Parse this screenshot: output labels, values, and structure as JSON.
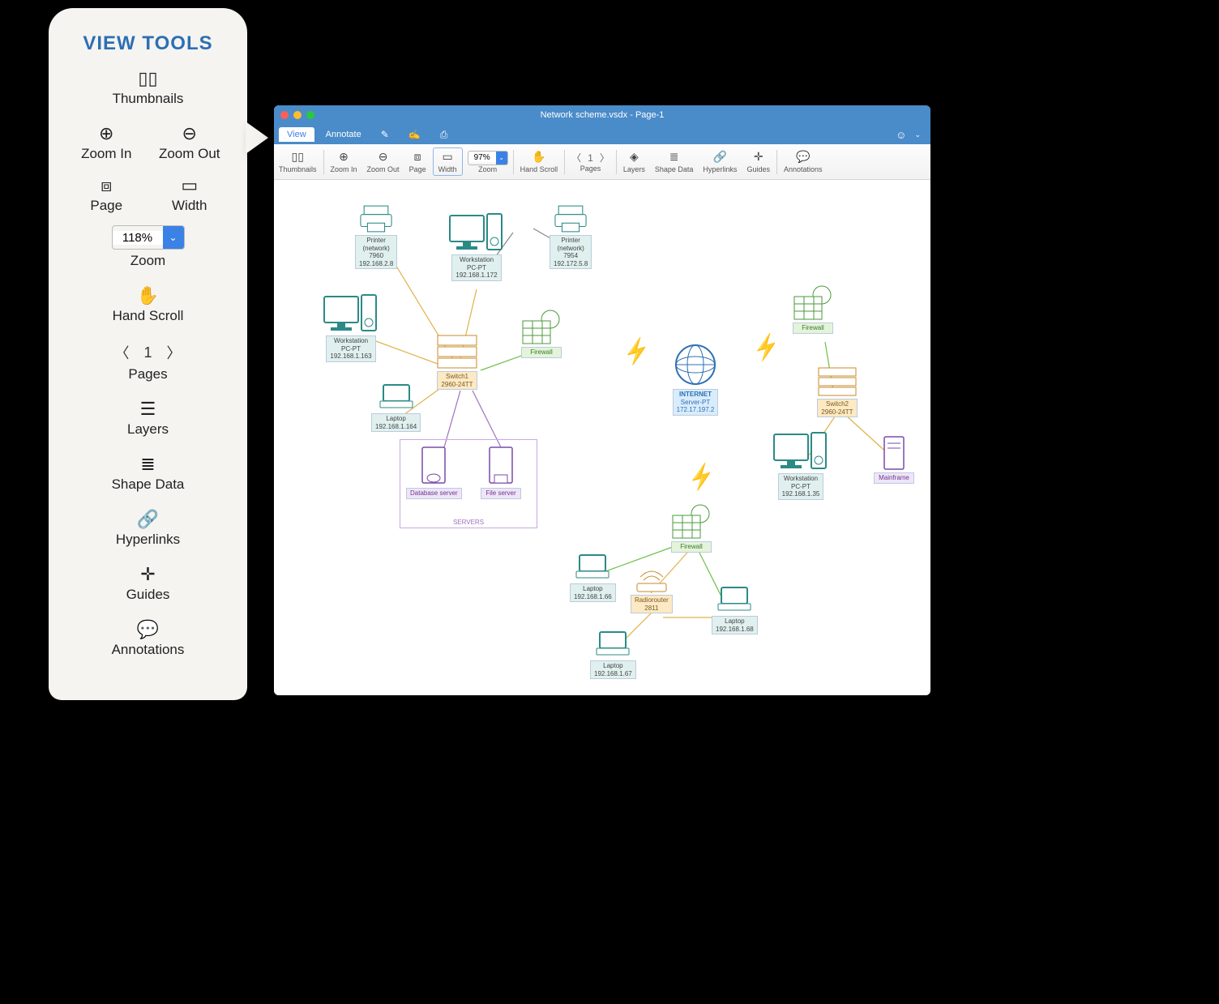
{
  "callout": {
    "title": "VIEW TOOLS",
    "thumbnails": "Thumbnails",
    "zoom_in": "Zoom In",
    "zoom_out": "Zoom Out",
    "page": "Page",
    "width": "Width",
    "zoom_value": "118%",
    "zoom_label": "Zoom",
    "hand_scroll": "Hand Scroll",
    "page_num": "1",
    "pages": "Pages",
    "layers": "Layers",
    "shape_data": "Shape Data",
    "hyperlinks": "Hyperlinks",
    "guides": "Guides",
    "annotations": "Annotations"
  },
  "app": {
    "title": "Network scheme.vsdx - Page-1",
    "menu": {
      "view": "View",
      "annotate": "Annotate"
    },
    "toolbar": {
      "thumbnails": "Thumbnails",
      "zoom_in": "Zoom In",
      "zoom_out": "Zoom Out",
      "page": "Page",
      "width": "Width",
      "zoom_value": "97%",
      "zoom_label": "Zoom",
      "hand_scroll": "Hand Scroll",
      "page_num": "1",
      "pages": "Pages",
      "layers": "Layers",
      "shape_data": "Shape Data",
      "hyperlinks": "Hyperlinks",
      "guides": "Guides",
      "annotations": "Annotations"
    }
  },
  "diagram": {
    "servers_label": "SERVERS",
    "nodes": {
      "printer1": {
        "l1": "Printer",
        "l2": "(network)",
        "l3": "7960",
        "l4": "192.168.2.8"
      },
      "printer2": {
        "l1": "Printer",
        "l2": "(network)",
        "l3": "7954",
        "l4": "192.172.5.8"
      },
      "ws_top": {
        "l1": "Workstation",
        "l2": "PC-PT",
        "l3": "192.168.1.172"
      },
      "ws_left": {
        "l1": "Workstation",
        "l2": "PC-PT",
        "l3": "192.168.1.163"
      },
      "ws_right": {
        "l1": "Workstation",
        "l2": "PC-PT",
        "l3": "192.168.1.35"
      },
      "laptop1": {
        "l1": "Laptop",
        "l2": "192.168.1.164"
      },
      "laptop2": {
        "l1": "Laptop",
        "l2": "192.168.1.66"
      },
      "laptop3": {
        "l1": "Laptop",
        "l2": "192.168.1.67"
      },
      "laptop4": {
        "l1": "Laptop",
        "l2": "192.168.1.68"
      },
      "switch1": {
        "l1": "Switch1",
        "l2": "2960-24TT"
      },
      "switch2": {
        "l1": "Switch2",
        "l2": "2960-24TT"
      },
      "fw1": {
        "l1": "Firewall"
      },
      "fw2": {
        "l1": "Firewall"
      },
      "fw3": {
        "l1": "Firewall"
      },
      "db": {
        "l1": "Database server"
      },
      "fs": {
        "l1": "File server"
      },
      "mf": {
        "l1": "Mainframe"
      },
      "router": {
        "l1": "Radiorouter",
        "l2": "2811"
      },
      "internet": {
        "l1": "INTERNET",
        "l2": "Server-PT",
        "l3": "172.17.197.2"
      }
    }
  }
}
